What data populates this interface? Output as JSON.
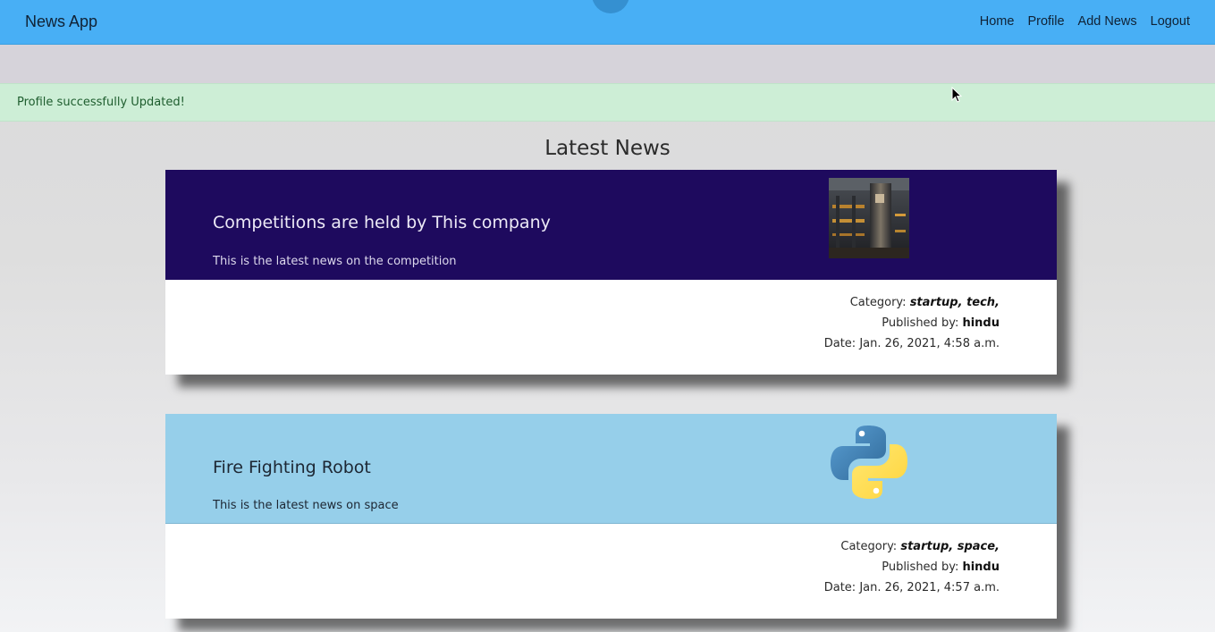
{
  "navbar": {
    "brand": "News App",
    "links": [
      "Home",
      "Profile",
      "Add News",
      "Logout"
    ]
  },
  "alert": {
    "message": "Profile successfully Updated!"
  },
  "section": {
    "title": "Latest News"
  },
  "labels": {
    "category": "Category:",
    "published_by": "Published by:",
    "date": "Date:"
  },
  "news": [
    {
      "title": "Competitions are held by This company",
      "description": "This is the latest news on the competition",
      "category": "startup, tech,",
      "publisher": "hindu",
      "date": "Jan. 26, 2021, 4:58 a.m.",
      "image": "factory-photo",
      "header_color": "#1e0a5e"
    },
    {
      "title": "Fire Fighting Robot",
      "description": "This is the latest news on space",
      "category": "startup, space,",
      "publisher": "hindu",
      "date": "Jan. 26, 2021, 4:57 a.m.",
      "image": "python-logo",
      "header_color": "#96cfea"
    }
  ],
  "colors": {
    "navbar": "#48aff5",
    "alert_bg": "#cdeed6",
    "alert_text": "#1e5d2e"
  }
}
